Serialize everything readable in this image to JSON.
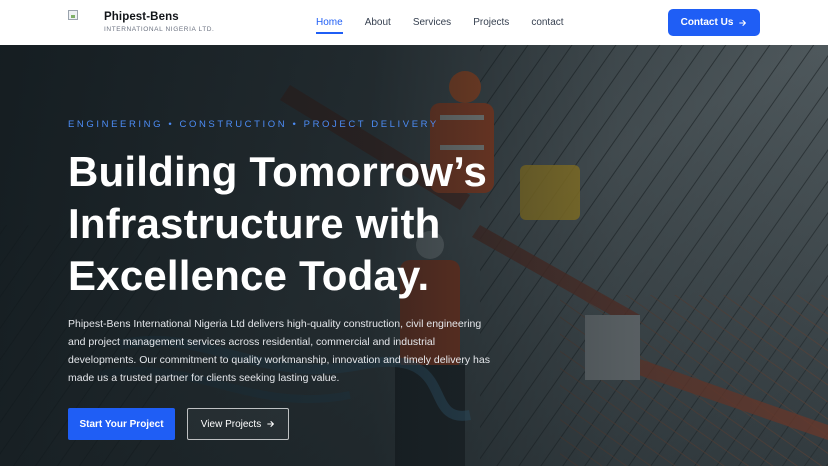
{
  "brand": {
    "name": "Phipest-Bens",
    "subtitle": "INTERNATIONAL NIGERIA LTD.",
    "logo_icon": "broken-image-icon"
  },
  "nav": {
    "items": [
      {
        "label": "Home",
        "active": true
      },
      {
        "label": "About",
        "active": false
      },
      {
        "label": "Services",
        "active": false
      },
      {
        "label": "Projects",
        "active": false
      },
      {
        "label": "contact",
        "active": false
      }
    ],
    "contact_button": "Contact Us",
    "contact_icon": "arrow-right-icon"
  },
  "hero": {
    "eyebrow": "ENGINEERING • CONSTRUCTION • PROJECT DELIVERY",
    "title_lines": [
      "Building Tomorrow’s",
      "Infrastructure with",
      "Excellence Today."
    ],
    "description": "Phipest-Bens International Nigeria Ltd delivers high-quality construction, civil engineering and project management services across residential, commercial and industrial developments. Our commitment to quality workmanship, innovation and timely delivery has made us a trusted partner for clients seeking lasting value.",
    "primary_button": "Start Your Project",
    "secondary_button": "View Projects",
    "secondary_icon": "arrow-right-icon"
  },
  "colors": {
    "accent": "#1f5ef5",
    "eyebrow": "#4c8cf5",
    "overlay": "#0e161a"
  }
}
